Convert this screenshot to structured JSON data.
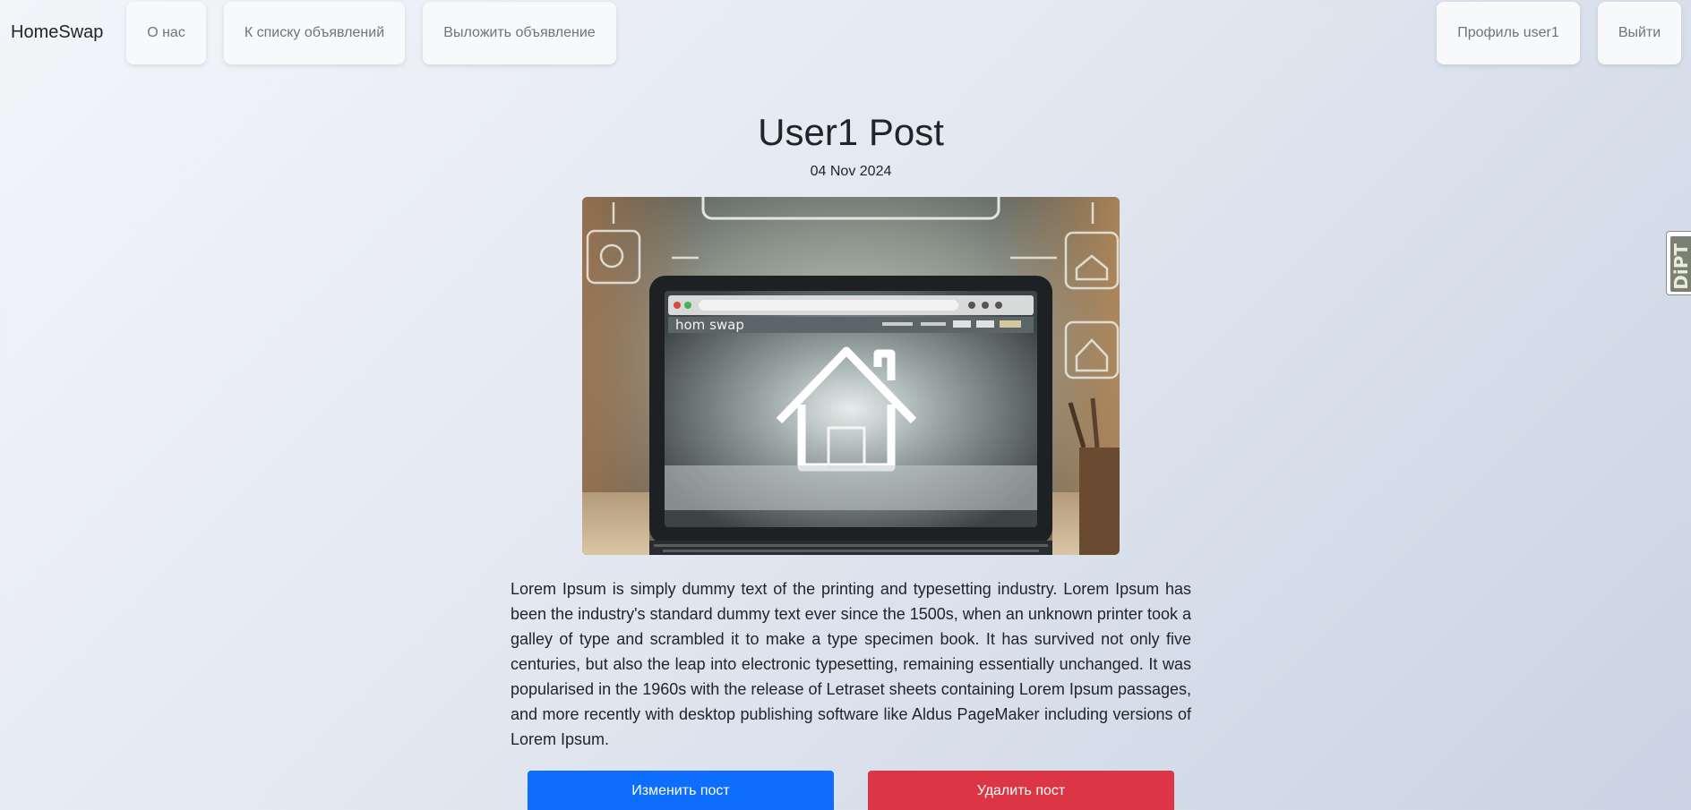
{
  "navbar": {
    "brand": "HomeSwap",
    "about": "О нас",
    "listings": "К списку объявлений",
    "new_post": "Выложить объявление",
    "profile": "Профиль user1",
    "logout": "Выйти"
  },
  "post": {
    "title": "User1 Post",
    "date": "04 Nov 2024",
    "image_caption": "hom swap",
    "body": "Lorem Ipsum is simply dummy text of the printing and typesetting industry. Lorem Ipsum has been the industry's standard dummy text ever since the 1500s, when an unknown printer took a galley of type and scrambled it to make a type specimen book. It has survived not only five centuries, but also the leap into electronic typesetting, remaining essentially unchanged. It was popularised in the 1960s with the release of Letraset sheets containing Lorem Ipsum passages, and more recently with desktop publishing software like Aldus PageMaker including versions of Lorem Ipsum.",
    "edit_button": "Изменить пост",
    "delete_button": "Удалить пост"
  },
  "side_widget": {
    "label": "DiPT"
  },
  "colors": {
    "primary": "#0d6efd",
    "danger": "#dc3545",
    "nav_button_bg": "#f8f9fa",
    "nav_text": "#6c757d"
  }
}
